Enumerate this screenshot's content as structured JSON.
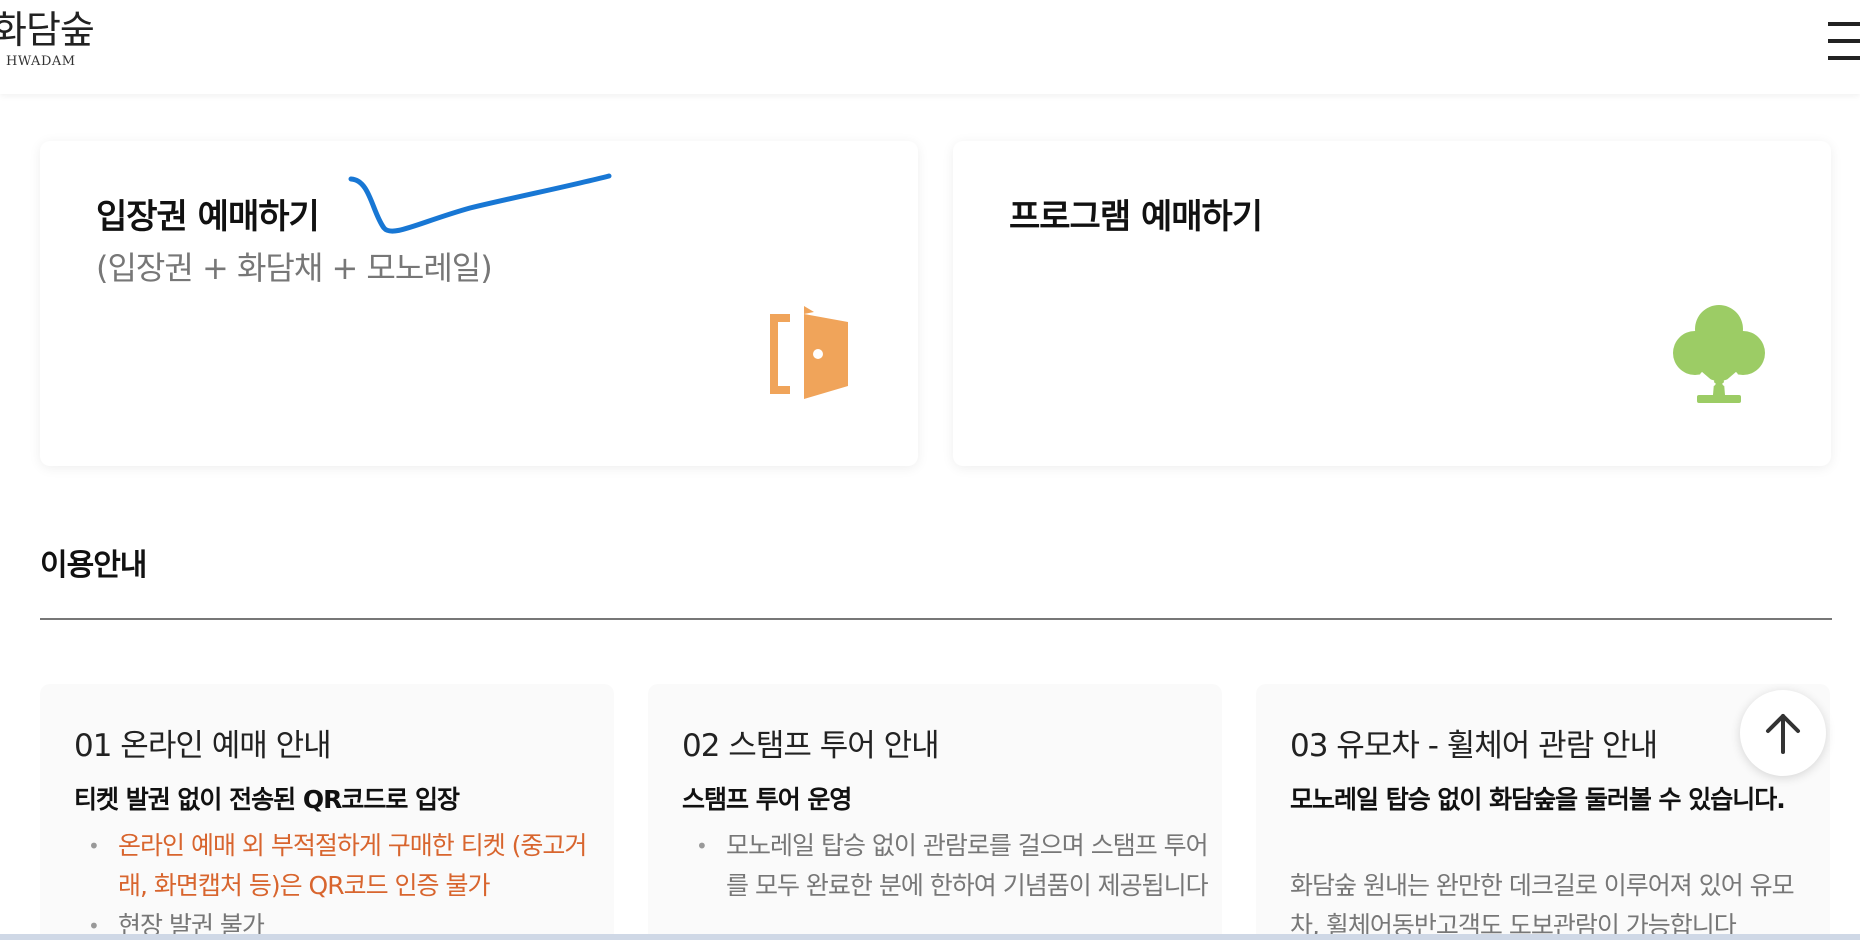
{
  "header": {
    "logo_main": "화담숲",
    "logo_sub": "HWADAM"
  },
  "cards": [
    {
      "title": "입장권 예매하기",
      "subtitle": "(입장권 + 화담채 + 모노레일)",
      "icon": "door-icon"
    },
    {
      "title": "프로그램 예매하기",
      "subtitle": "",
      "icon": "tree-icon"
    }
  ],
  "section": {
    "title": "이용안내"
  },
  "info": [
    {
      "title": "01 온라인 예매 안내",
      "lead": "티켓 발권 없이 전송된 QR코드로 입장",
      "items": [
        "온라인 예매 외 부적절하게 구매한 티켓 (중고거래, 화면캡처 등)은 QR코드 인증 불가",
        "현장 발권 불가"
      ]
    },
    {
      "title": "02 스탬프 투어 안내",
      "lead": "스탬프 투어 운영",
      "items": [
        "모노레일 탑승 없이 관람로를 걸으며 스탬프 투어를 모두 완료한 분에 한하여 기념품이 제공됩니다"
      ]
    },
    {
      "title": "03 유모차 - 휠체어 관람 안내",
      "lead": "모노레일 탑승 없이 화담숲을 둘러볼 수 있습니다.",
      "text": "화담숲 원내는 완만한 데크길로 이루어져 있어 유모차, 휠체어동반고객도 도보관람이 가능합니다"
    }
  ],
  "colors": {
    "accent_warn": "#d8652e",
    "door_icon": "#f0a45a",
    "tree_icon": "#9ccc65",
    "pen_mark": "#1877d4"
  },
  "icons": {
    "menu": "hamburger-menu-icon",
    "scroll_top": "arrow-up-icon"
  }
}
